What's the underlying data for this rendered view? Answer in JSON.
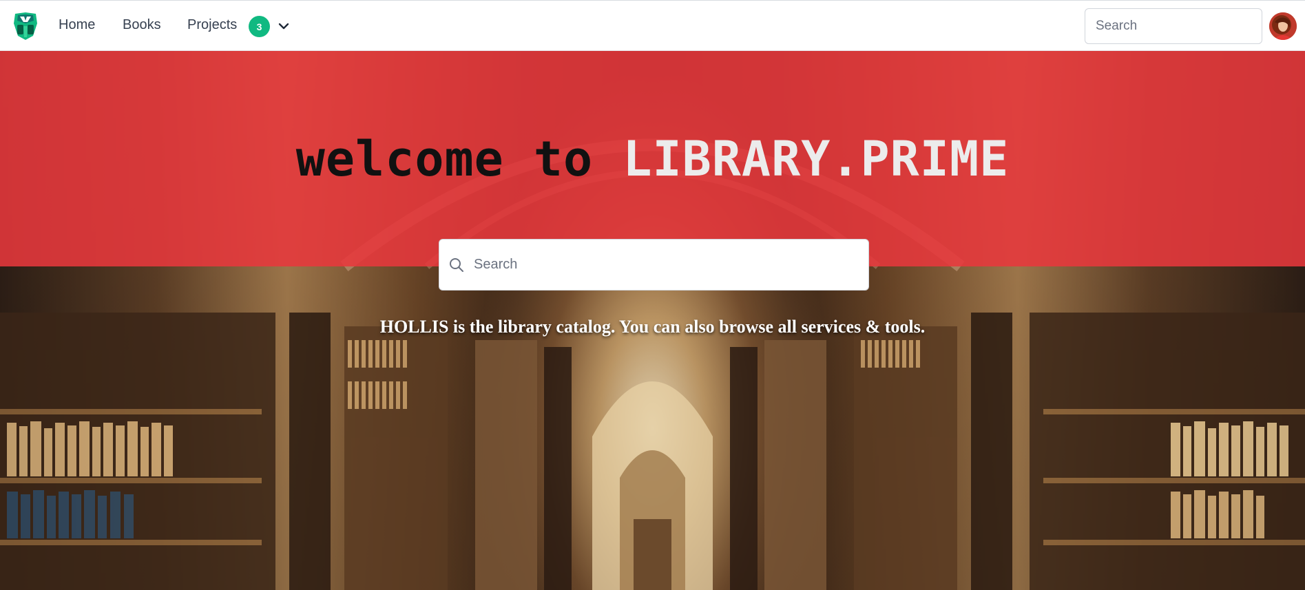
{
  "nav": {
    "logo_icon": "robot-logo-icon",
    "links": [
      {
        "label": "Home"
      },
      {
        "label": "Books"
      },
      {
        "label": "Projects"
      }
    ],
    "projects_badge": "3",
    "dropdown_icon": "chevron-down-icon",
    "search": {
      "placeholder": "Search",
      "value": ""
    },
    "avatar_icon": "user-avatar"
  },
  "hero": {
    "title_lead": "welcome to ",
    "title_brand": "LIBRARY.PRIME",
    "search": {
      "placeholder": "Search",
      "value": "",
      "icon": "search-icon"
    },
    "tagline": "HOLLIS is the library catalog. You can also browse all services & tools."
  },
  "colors": {
    "band_red": "#e7383c",
    "badge_green": "#10b981",
    "logo_green": "#10b981",
    "text_dark": "#374151"
  }
}
